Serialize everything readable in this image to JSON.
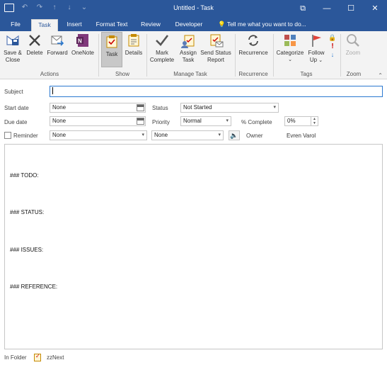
{
  "window": {
    "title": "Untitled - Task",
    "minimize": "—",
    "maximize": "☐",
    "close": "✕",
    "restore_icon": "⧉"
  },
  "qat": {
    "save_glyph": "💾",
    "undo_glyph": "↶",
    "redo_glyph": "↷",
    "up_glyph": "↑",
    "down_glyph": "↓",
    "more_glyph": "⌄"
  },
  "tabs": [
    {
      "label": "File"
    },
    {
      "label": "Task"
    },
    {
      "label": "Insert"
    },
    {
      "label": "Format Text"
    },
    {
      "label": "Review"
    },
    {
      "label": "Developer"
    }
  ],
  "tell_me": "Tell me what you want to do...",
  "ribbon": {
    "save_close": "Save & Close",
    "delete": "Delete",
    "forward": "Forward",
    "onenote": "OneNote",
    "task": "Task",
    "details": "Details",
    "mark_complete": "Mark Complete",
    "assign_task": "Assign Task",
    "send_status": "Send Status Report",
    "recurrence": "Recurrence",
    "categorize": "Categorize",
    "follow_up": "Follow Up",
    "zoom": "Zoom",
    "groups": {
      "actions": "Actions",
      "show": "Show",
      "manage": "Manage Task",
      "recurrence": "Recurrence",
      "tags": "Tags",
      "zoom": "Zoom"
    }
  },
  "form": {
    "subject_label": "Subject",
    "subject_value": "",
    "start_label": "Start date",
    "start_value": "None",
    "due_label": "Due date",
    "due_value": "None",
    "status_label": "Status",
    "status_value": "Not Started",
    "priority_label": "Priority",
    "priority_value": "Normal",
    "complete_label": "% Complete",
    "complete_value": "0%",
    "reminder_label": "Reminder",
    "reminder_date": "None",
    "reminder_time": "None",
    "owner_label": "Owner",
    "owner_value": "Evren Varol"
  },
  "body_lines": [
    "### TODO:",
    "### STATUS:",
    "### ISSUES:",
    "### REFERENCE:"
  ],
  "footer": {
    "in_folder_label": "In Folder",
    "folder_name": "zzNext"
  },
  "colors": {
    "titlebar": "#2b579a",
    "ribbon": "#f3f3f3"
  }
}
